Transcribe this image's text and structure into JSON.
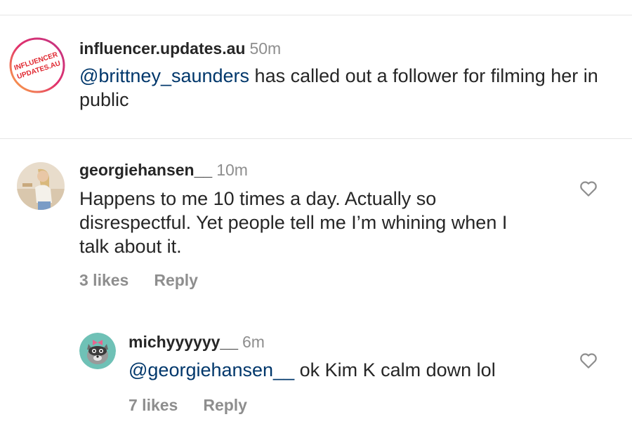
{
  "caption": {
    "username": "influencer.updates.au",
    "time": "50m",
    "mention": "@brittney_saunders",
    "text": " has called out a follower for filming her in public",
    "avatar_text": "INFLUENCER UPDATES.AU"
  },
  "comments": [
    {
      "username": "georgiehansen__",
      "time": "10m",
      "text": "Happens to me 10 times a day. Actually so disrespectful. Yet people tell me I’m whining when I talk about it.",
      "likes": "3 likes",
      "reply": "Reply"
    },
    {
      "username": "michyyyyyy__",
      "time": "6m",
      "mention": "@georgiehansen__",
      "text": " ok Kim K calm down lol",
      "likes": "7 likes",
      "reply": "Reply"
    }
  ],
  "colors": {
    "mention": "#00376b",
    "meta": "#8e8e8e",
    "text": "#262626",
    "brand_red": "#e0262f"
  }
}
